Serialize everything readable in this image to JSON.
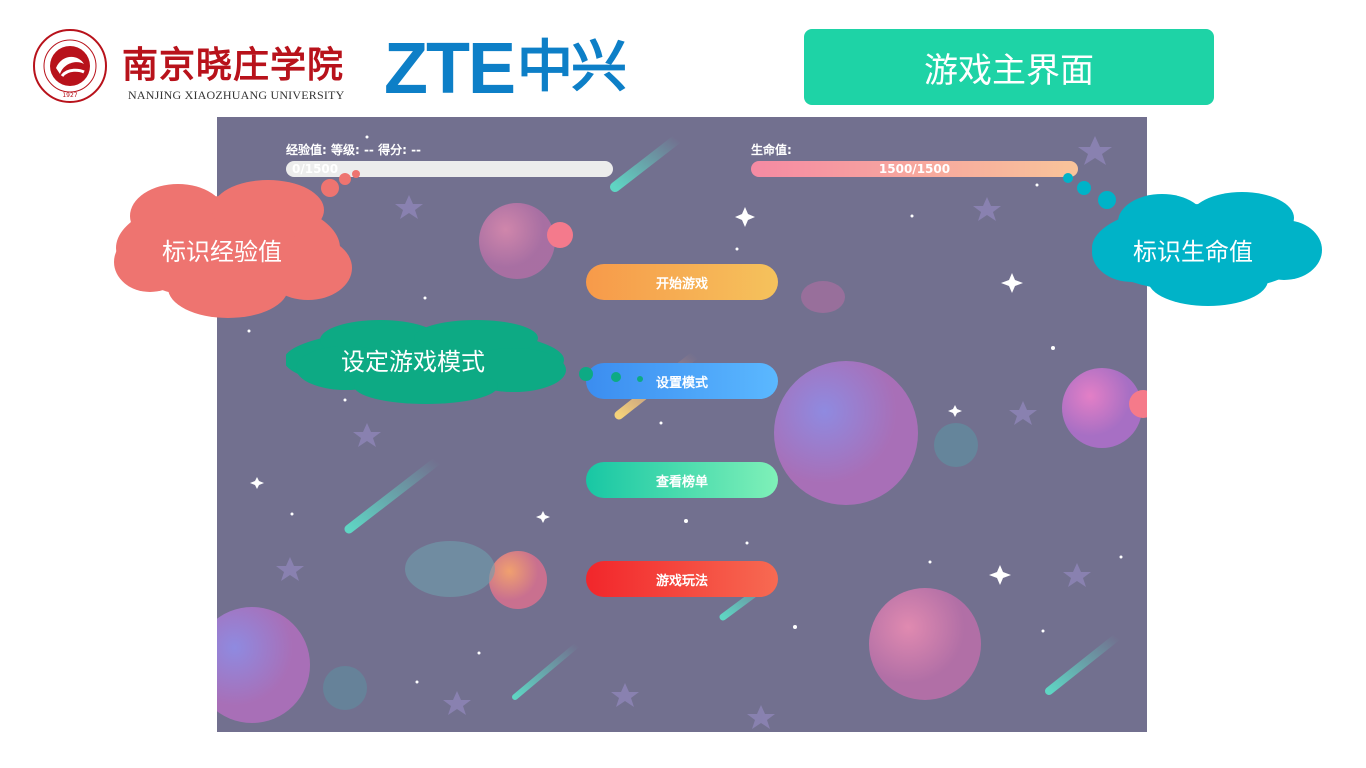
{
  "header": {
    "university_cn": "南京晓庄学院",
    "university_en": "NANJING XIAOZHUANG UNIVERSITY",
    "seal_text": "Nanjing Xiaozhuang University",
    "seal_year": "1927",
    "brand_en": "ZTE",
    "brand_cn": "中兴",
    "page_title": "游戏主界面"
  },
  "hud": {
    "exp_label": "经验值: 等级: --    得分: --",
    "exp_value": "0/1500",
    "exp_fraction": 0,
    "life_label": "生命值:",
    "life_value": "1500/1500",
    "life_fraction": 1
  },
  "menu": {
    "start": "开始游戏",
    "mode": "设置模式",
    "rank": "查看榜单",
    "rules": "游戏玩法"
  },
  "callouts": {
    "exp": "标识经验值",
    "life": "标识生命值",
    "mode": "设定游戏模式"
  },
  "colors": {
    "title_box": "#1ed3a6",
    "game_bg": "#72708f",
    "callout_exp": "#ee7470",
    "callout_life": "#00b3c8",
    "callout_mode": "#0daa84",
    "zte_blue": "#0d7fc7"
  }
}
